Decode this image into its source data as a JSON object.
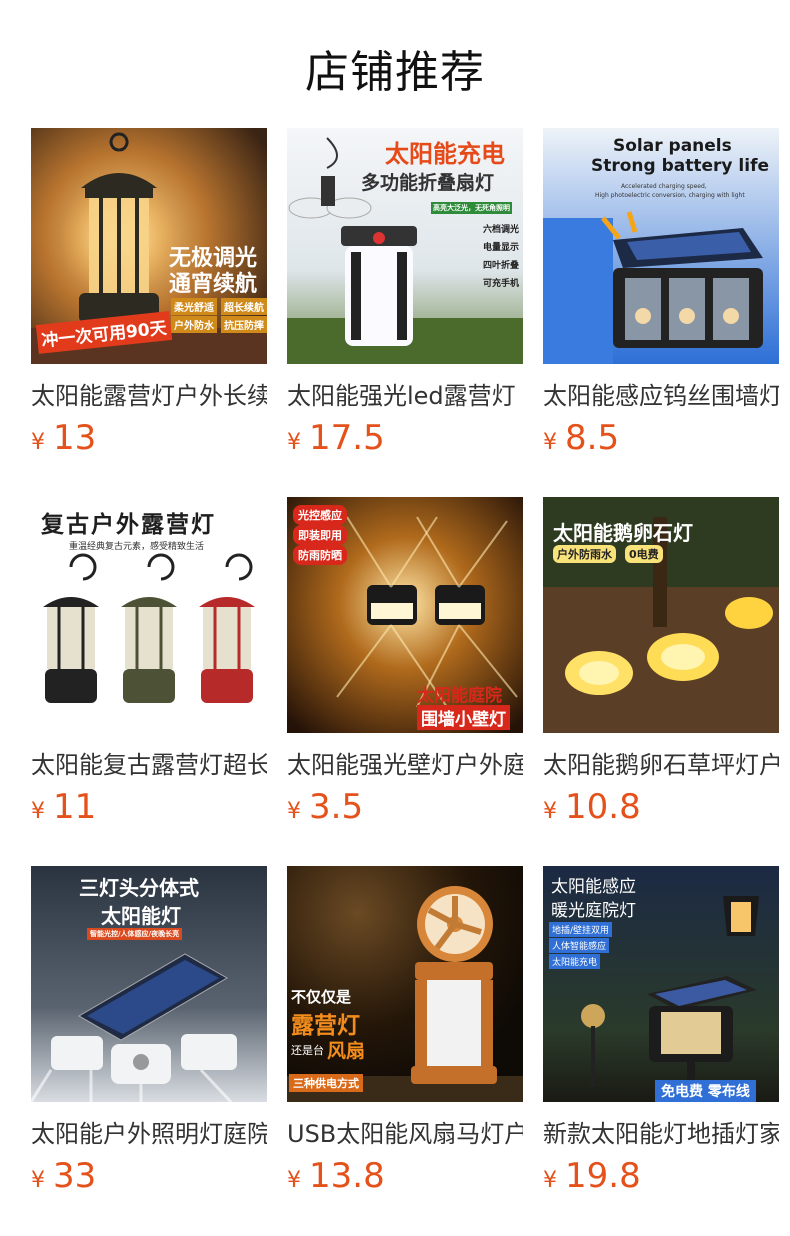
{
  "page_title": "店铺推荐",
  "currency_symbol": "¥",
  "products": [
    {
      "name": "太阳能露营灯户外长续航",
      "price": "13",
      "overlay": [
        "无极调光",
        "通宵续航",
        "柔光舒适",
        "超长续航",
        "户外防水",
        "抗压防摔",
        "冲一次可用90天"
      ]
    },
    {
      "name": "太阳能强光led露营灯",
      "price": "17.5",
      "overlay": [
        "太阳能充电",
        "多功能折叠扇灯",
        "高亮大泛光，无死角照明",
        "六档调光",
        "电量显示",
        "四叶折叠",
        "可充手机"
      ]
    },
    {
      "name": "太阳能感应钨丝围墙灯",
      "price": "8.5",
      "overlay": [
        "Solar panels",
        "Strong battery life",
        "Accelerated charging speed,",
        "High photoelectric conversion, charging with light"
      ]
    },
    {
      "name": "太阳能复古露营灯超长续航",
      "price": "11",
      "overlay": [
        "复古户外露营灯",
        "重温经典复古元素，感受精致生活"
      ]
    },
    {
      "name": "太阳能强光壁灯户外庭院",
      "price": "3.5",
      "overlay": [
        "光控感应",
        "即装即用",
        "防雨防晒",
        "太阳能庭院",
        "围墙小壁灯"
      ]
    },
    {
      "name": "太阳能鹅卵石草坪灯户外",
      "price": "10.8",
      "overlay": [
        "太阳能鹅卵石灯",
        "户外防雨水",
        "0电费"
      ]
    },
    {
      "name": "太阳能户外照明灯庭院",
      "price": "33",
      "overlay": [
        "三灯头分体式",
        "太阳能灯",
        "智能光控/人体感应/夜晚长亮"
      ]
    },
    {
      "name": "USB太阳能风扇马灯户外",
      "price": "13.8",
      "overlay": [
        "不仅仅是",
        "露营灯",
        "还是台",
        "风扇",
        "三种供电方式"
      ]
    },
    {
      "name": "新款太阳能灯地插灯家用",
      "price": "19.8",
      "overlay": [
        "太阳能感应",
        "暖光庭院灯",
        "地插/壁挂双用",
        "人体智能感应",
        "太阳能充电",
        "免电费 零布线"
      ]
    }
  ]
}
